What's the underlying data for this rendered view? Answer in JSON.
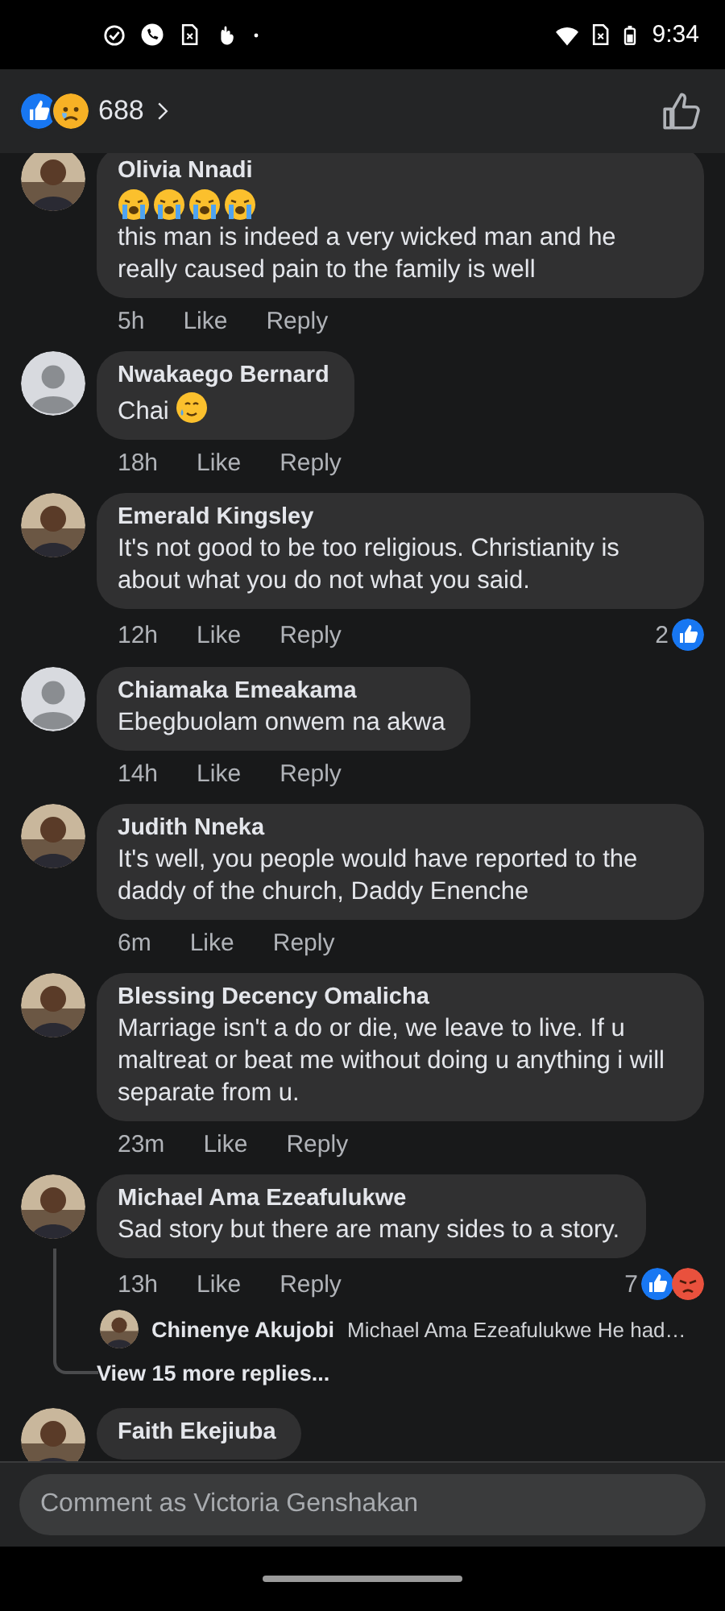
{
  "status_bar": {
    "time": "9:34"
  },
  "header": {
    "reactions": [
      {
        "kind": "like"
      },
      {
        "kind": "sad"
      }
    ],
    "count": "688"
  },
  "comments": [
    {
      "name": "Olivia Nnadi",
      "avatar": {
        "kind": "picture"
      },
      "emoji_before": [
        {
          "kind": "crying"
        },
        {
          "kind": "crying"
        },
        {
          "kind": "crying"
        },
        {
          "kind": "crying"
        }
      ],
      "text": "this man is indeed a very wicked man  and he really caused pain to the family is well",
      "time": "5h",
      "like": "Like",
      "reply": "Reply"
    },
    {
      "name": "Nwakaego Bernard",
      "avatar": {
        "kind": "placeholder"
      },
      "text": "Chai",
      "emoji_after": [
        {
          "kind": "tearful"
        }
      ],
      "time": "18h",
      "like": "Like",
      "reply": "Reply"
    },
    {
      "name": "Emerald Kingsley",
      "avatar": {
        "kind": "picture"
      },
      "text": "It's not good to be too religious. Christianity is about what you do not what you said.",
      "time": "12h",
      "like": "Like",
      "reply": "Reply",
      "reaction_count": "2",
      "reactions": [
        {
          "kind": "like"
        }
      ]
    },
    {
      "name": "Chiamaka Emeakama",
      "avatar": {
        "kind": "placeholder"
      },
      "text": "Ebegbuolam onwem na akwa",
      "time": "14h",
      "like": "Like",
      "reply": "Reply"
    },
    {
      "name": "Judith Nneka",
      "avatar": {
        "kind": "picture"
      },
      "text": "It's well, you people would have reported to the daddy of the church, Daddy Enenche",
      "time": "6m",
      "like": "Like",
      "reply": "Reply"
    },
    {
      "name": "Blessing Decency Omalicha",
      "avatar": {
        "kind": "picture"
      },
      "text": "Marriage isn't a do or die, we leave to live. If u maltreat or beat me without doing u anything i will separate from u.",
      "time": "23m",
      "like": "Like",
      "reply": "Reply"
    },
    {
      "name": "Michael Ama Ezeafulukwe",
      "avatar": {
        "kind": "picture"
      },
      "text": "Sad story but there are many sides to a story.",
      "time": "13h",
      "like": "Like",
      "reply": "Reply",
      "reaction_count": "7",
      "reactions": [
        {
          "kind": "like"
        },
        {
          "kind": "angry"
        }
      ],
      "replies": [
        {
          "name": "Chinenye Akujobi",
          "avatar": {
            "kind": "picture"
          },
          "text": "Michael Ama Ezeafulukwe He had…"
        }
      ],
      "more_replies": "View 15 more replies..."
    },
    {
      "name": "Faith Ekejiuba",
      "avatar": {
        "kind": "picture"
      }
    }
  ],
  "composer": {
    "placeholder": "Comment as Victoria Genshakan"
  }
}
